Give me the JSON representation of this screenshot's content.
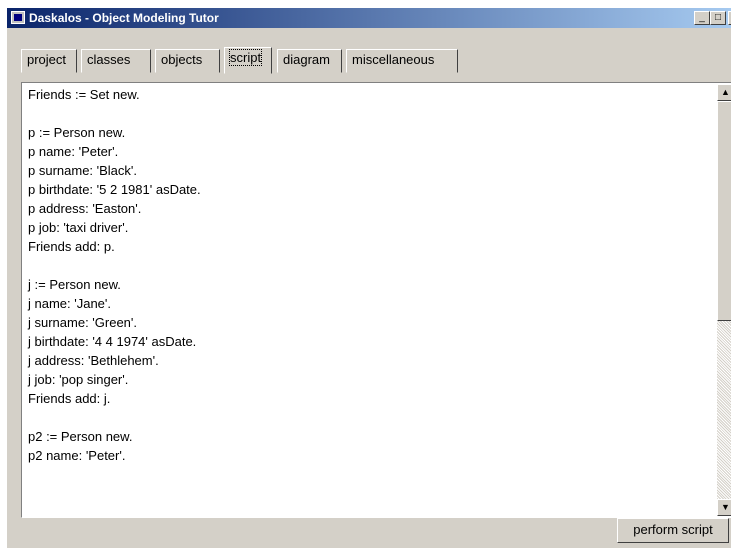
{
  "window": {
    "title": "Daskalos - Object Modeling Tutor",
    "controls": {
      "minimize": "_",
      "maximize": "□",
      "close": "×"
    }
  },
  "tabs": [
    {
      "label": "project"
    },
    {
      "label": "classes"
    },
    {
      "label": "objects"
    },
    {
      "label": "script",
      "active": true
    },
    {
      "label": "diagram"
    },
    {
      "label": "miscellaneous"
    }
  ],
  "script_lines": [
    "Friends := Set new.",
    "",
    "p := Person new.",
    "p name: 'Peter'.",
    "p surname: 'Black'.",
    "p birthdate: '5 2 1981' asDate.",
    "p address: 'Easton'.",
    "p job: 'taxi driver'.",
    "Friends add: p.",
    "",
    "j := Person new.",
    "j name: 'Jane'.",
    "j surname: 'Green'.",
    "j birthdate: '4 4 1974' asDate.",
    "j address: 'Bethlehem'.",
    "j job: 'pop singer'.",
    "Friends add: j.",
    "",
    "p2 := Person new.",
    "p2 name: 'Peter'."
  ],
  "scrollbar": {
    "up": "▲",
    "down": "▼"
  },
  "actions": {
    "perform_script": "perform script"
  }
}
